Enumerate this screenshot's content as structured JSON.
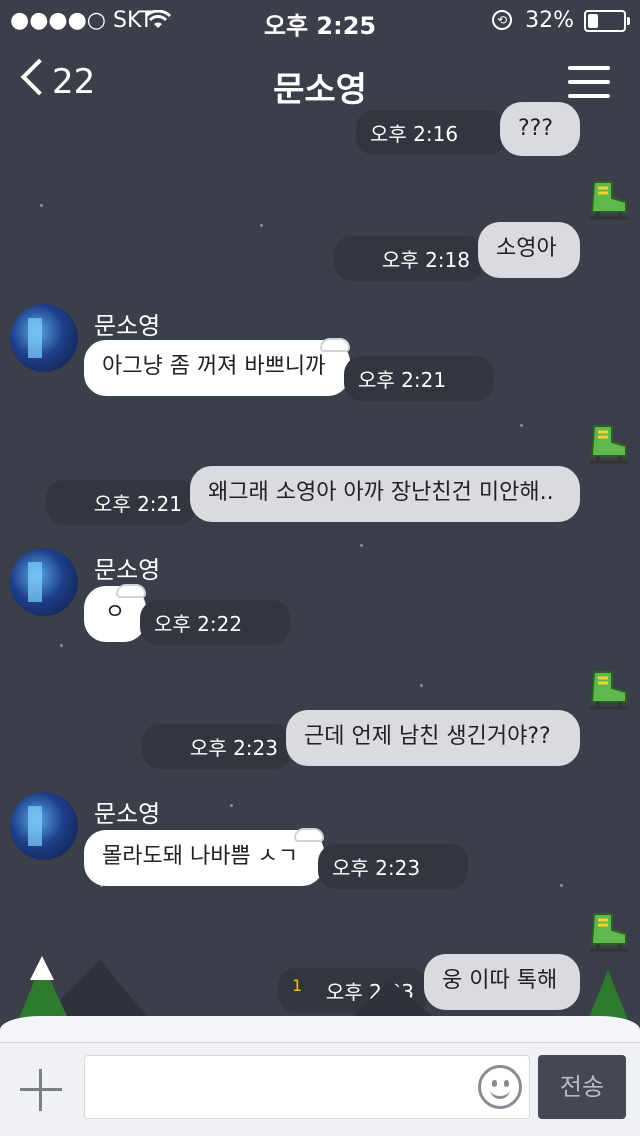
{
  "status_bar": {
    "signal": "●●●●○",
    "carrier": "SKT",
    "time": "오후 2:25",
    "battery_text": "32%",
    "battery_level": 0.32
  },
  "header": {
    "back_count": "22",
    "title": "문소영"
  },
  "messages": [
    {
      "side": "me",
      "text": "???",
      "time": "오후 2:16"
    },
    {
      "side": "me",
      "text": "소영아",
      "time": "오후 2:18"
    },
    {
      "side": "them",
      "sender": "문소영",
      "text": "아그냥 좀 꺼져 바쁘니까",
      "time": "오후 2:21"
    },
    {
      "side": "me",
      "text": "왜그래 소영아 아까 장난친건 미안해..",
      "time": "오후 2:21"
    },
    {
      "side": "them",
      "sender": "문소영",
      "text": "ㅇ",
      "time": "오후 2:22"
    },
    {
      "side": "me",
      "text": "근데 언제 남친 생긴거야??",
      "time": "오후 2:23"
    },
    {
      "side": "them",
      "sender": "문소영",
      "text": "몰라도돼 나바쁨 ㅅㄱ",
      "time": "오후 2:23"
    },
    {
      "side": "me",
      "text": "웅 이따 톡해",
      "time": "오후 2:23",
      "unread": "1"
    }
  ],
  "input": {
    "placeholder": "",
    "send_label": "전송"
  },
  "colors": {
    "background": "#3b3f4a",
    "my_bubble": "#dadbe0",
    "their_bubble": "#ffffff",
    "unread": "#f5c400"
  }
}
